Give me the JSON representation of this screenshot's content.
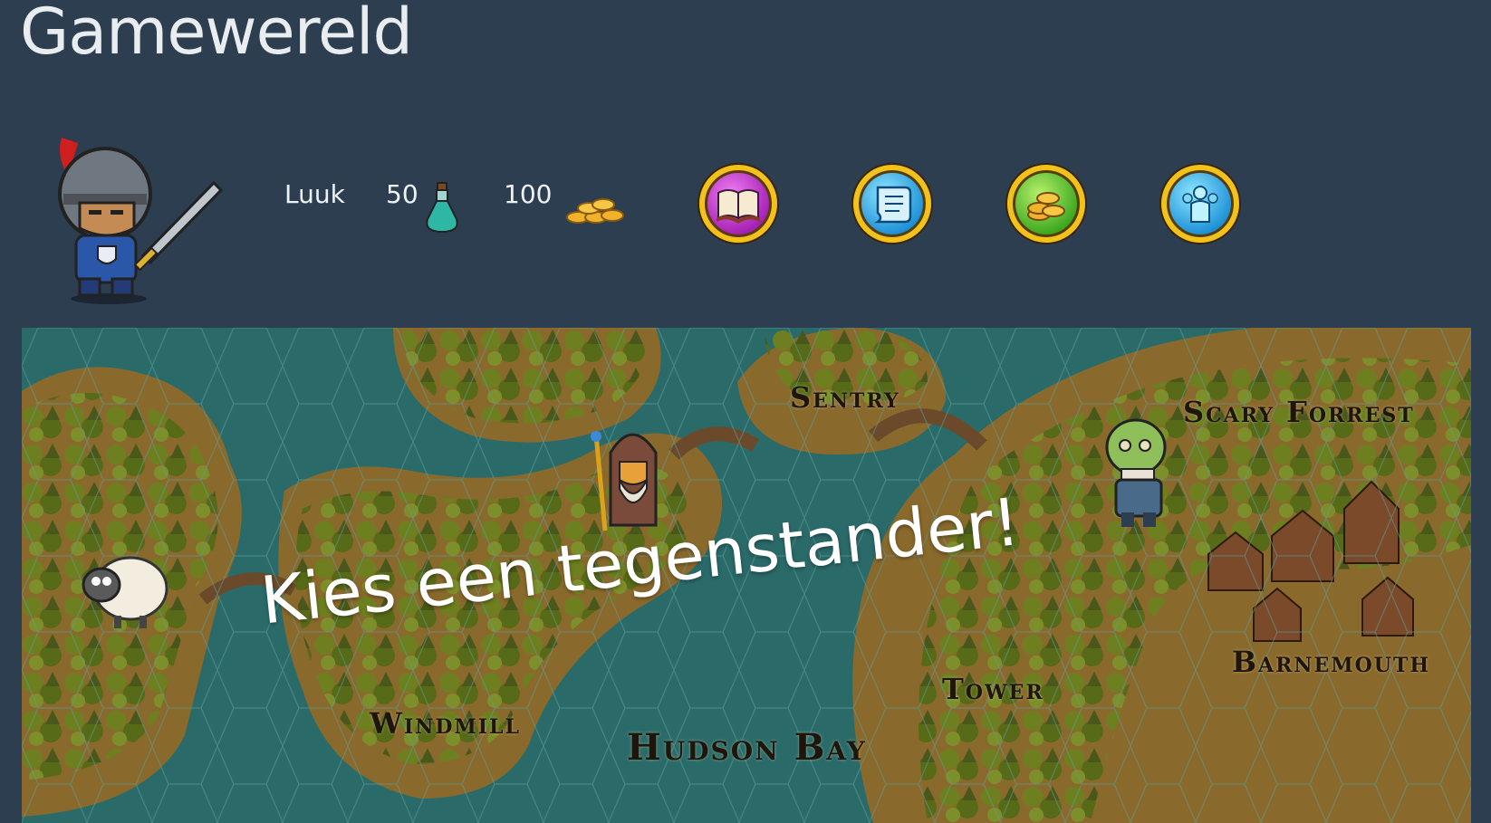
{
  "page": {
    "title": "Gamewereld"
  },
  "player": {
    "name": "Luuk",
    "potions": "50",
    "coins": "100",
    "avatar_icon": "knight-avatar",
    "potion_icon": "potion-icon",
    "coins_icon": "coins-icon"
  },
  "menu": [
    {
      "icon": "spellbook-icon",
      "color": "#a21fb3"
    },
    {
      "icon": "scroll-icon",
      "color": "#1b8fd6"
    },
    {
      "icon": "coin-stack-icon",
      "color": "#3aa61e"
    },
    {
      "icon": "party-icon",
      "color": "#1b8fd6"
    }
  ],
  "map": {
    "prompt": "Kies een tegenstander!",
    "locations": {
      "sentry": "Sentry",
      "scary_forrest": "Scary Forrest",
      "barnemouth": "Barnemouth",
      "tower": "Tower",
      "windmill": "Windmill",
      "hudson_bay": "Hudson Bay"
    },
    "opponents": [
      "sheep",
      "wizard",
      "zombie"
    ]
  },
  "colors": {
    "background": "#2c3e50",
    "water": "#2a6b6a",
    "land": "#8a6a2c",
    "forest": "#5f7a1f",
    "ring": "#f2c21a"
  }
}
